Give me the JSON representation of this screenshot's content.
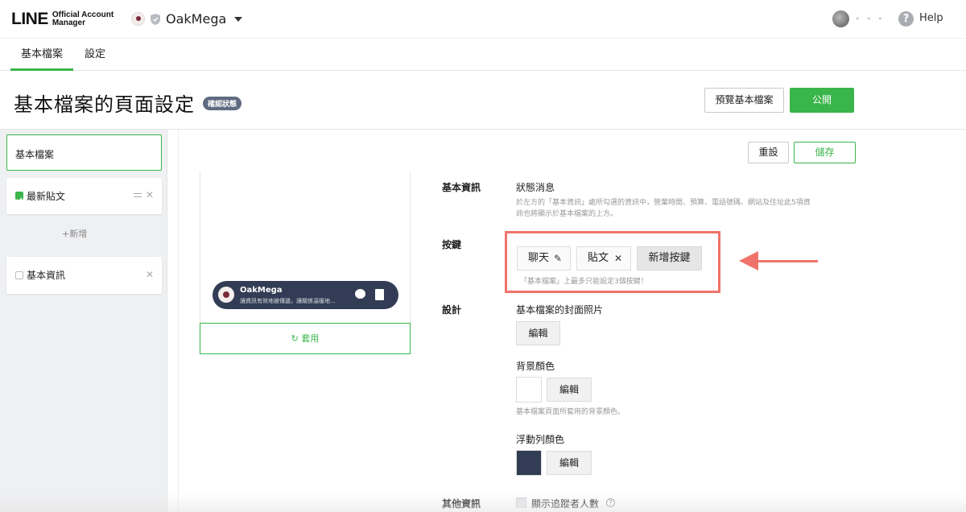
{
  "header": {
    "logo_line": "LINE",
    "logo_sub_1": "Official Account",
    "logo_sub_2": "Manager",
    "account_name": "OakMega",
    "user_name": "• • •",
    "help_label": "Help"
  },
  "tabs": [
    {
      "label": "基本檔案",
      "active": true
    },
    {
      "label": "設定",
      "active": false
    }
  ],
  "page": {
    "title": "基本檔案的頁面設定",
    "status_badge": "確認狀態",
    "preview_button": "預覽基本檔案",
    "publish_button": "公開",
    "reset_button": "重設",
    "save_button": "儲存"
  },
  "sidebar": {
    "items": [
      {
        "label": "基本檔案",
        "selected": true
      },
      {
        "label": "最新貼文",
        "checked": true
      },
      {
        "label": "基本資訊",
        "checked": false
      }
    ],
    "add_label": "+新增"
  },
  "preview": {
    "floatbar_name": "OakMega",
    "floatbar_text": "讓資訊有效地被傳遞，讓關係溫暖地...",
    "apply_button": "↻ 套用"
  },
  "form": {
    "basic_info": {
      "section": "基本資訊",
      "field": "狀態消息",
      "help_line_1": "於左方的「基本資訊」處所勾選的資訊中，營業時間、預算、電話號碼、網站及住址此5項資",
      "help_line_2": "訊也將顯示於基本檔案的上方。"
    },
    "buttons": {
      "section": "按鍵",
      "chip_chat": "聊天",
      "chip_post": "貼文",
      "add_button": "新增按鍵",
      "limit_note": "「基本檔案」上最多只能設定3個按鍵！"
    },
    "design": {
      "section": "設計",
      "cover_label": "基本檔案的封面照片",
      "edit_label": "編輯",
      "bg_color_label": "背景顏色",
      "bg_color": "#ffffff",
      "bg_help": "基本檔案頁面所套用的背景顏色。",
      "floatbar_color_label": "浮動列顏色",
      "floatbar_color": "#323d55"
    },
    "other": {
      "section": "其他資訊",
      "show_followers": "顯示追蹤者人數",
      "info_glyph": "?"
    }
  },
  "colors": {
    "accent_green": "#3ab54a",
    "highlight_red": "#f0736b",
    "floatbar_navy": "#323d55"
  }
}
